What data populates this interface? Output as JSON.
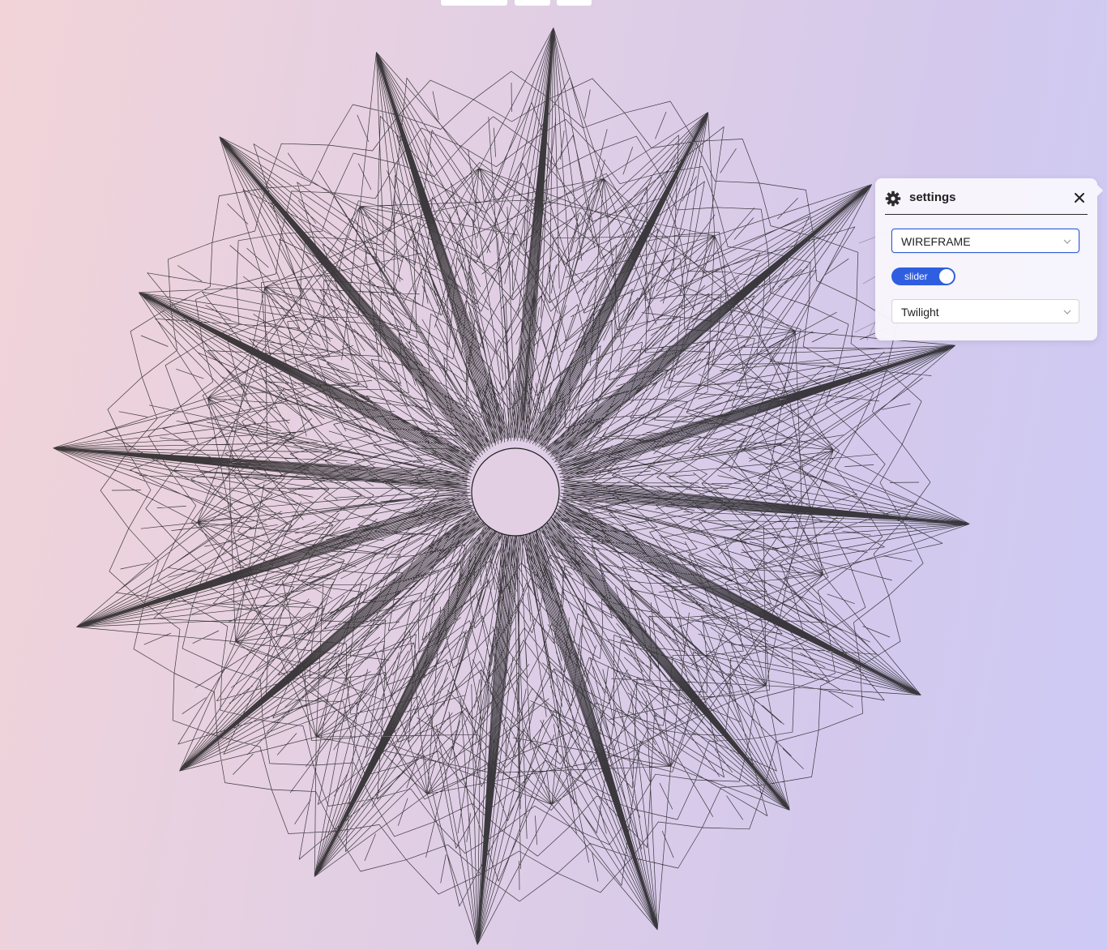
{
  "top_tabs": [
    "",
    "",
    ""
  ],
  "settings_panel": {
    "title": "settings",
    "icons": {
      "header": "gear-icon",
      "close": "close-icon",
      "dropdown": "chevron-down-icon"
    },
    "render_mode": {
      "value": "WIREFRAME"
    },
    "toggle": {
      "label": "slider",
      "on": true
    },
    "palette": {
      "value": "Twilight"
    }
  },
  "colors": {
    "accent": "#2f5fe0",
    "wireframe": "#1e1e1e",
    "background_start": "#f2d4d8",
    "background_end": "#cdcaf6"
  }
}
